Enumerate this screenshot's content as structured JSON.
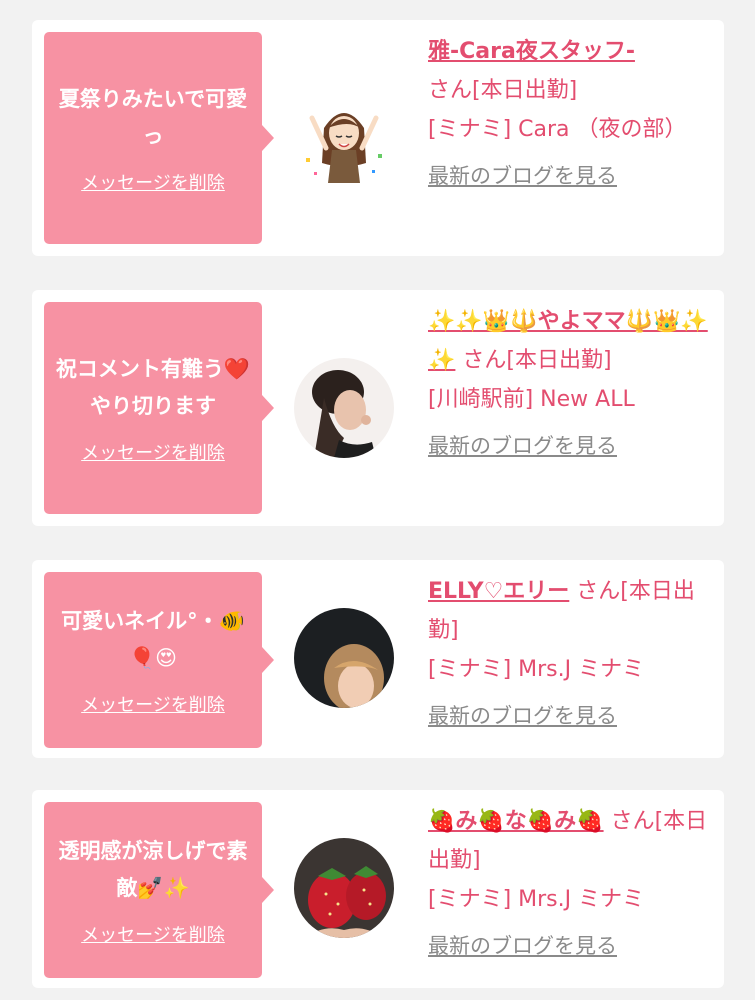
{
  "cards": [
    {
      "message": "夏祭りみたいで可愛っ",
      "delete_label": "メッセージを削除",
      "name": "雅-Cara夜スタッフ-",
      "status": "さん[本日出勤]",
      "shop": "[ミナミ] Cara （夜の部）",
      "blog_label": "最新のブログを見る"
    },
    {
      "message": "祝コメント有難う❤️やり切ります",
      "delete_label": "メッセージを削除",
      "name": "✨✨👑🔱やよママ🔱👑✨✨",
      "status": "さん[本日出勤]",
      "shop": "[川崎駅前] New ALL",
      "blog_label": "最新のブログを見る"
    },
    {
      "message": "可愛いネイル°・🐠🎈😍",
      "delete_label": "メッセージを削除",
      "name": "ELLY♡エリー",
      "status": "さん[本日出勤]",
      "shop": "[ミナミ] Mrs.J ミナミ",
      "blog_label": "最新のブログを見る"
    },
    {
      "message": "透明感が涼しげで素敵💅✨",
      "delete_label": "メッセージを削除",
      "name": "🍓み🍓な🍓み🍓",
      "status": "さん[本日出勤]",
      "shop": "[ミナミ] Mrs.J ミナミ",
      "blog_label": "最新のブログを見る"
    }
  ],
  "colors": {
    "bubble": "#f792a3",
    "accent_text": "#e34d6f",
    "link_gray": "#8a8a8a",
    "background": "#f2f2f2"
  }
}
